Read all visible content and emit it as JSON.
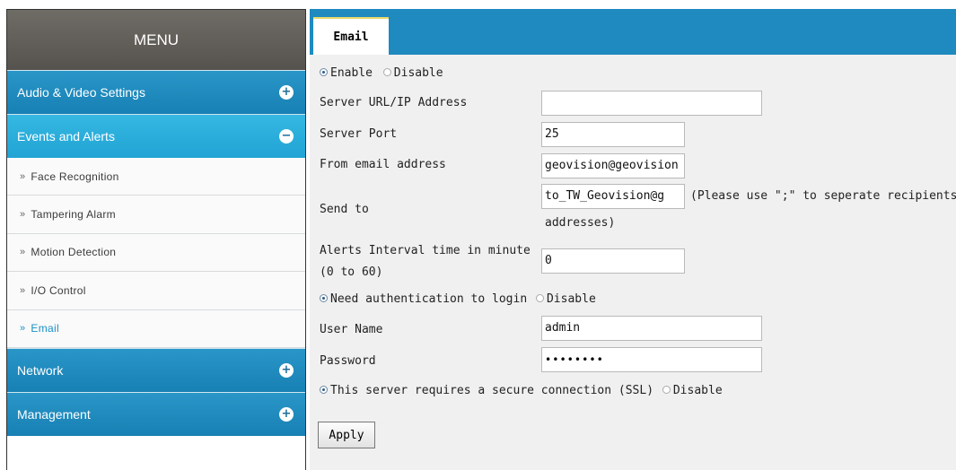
{
  "sidebar": {
    "title": "MENU",
    "categories": [
      {
        "label": "Audio & Video Settings",
        "toggle": "+"
      },
      {
        "label": "Events and Alerts",
        "toggle": "−"
      },
      {
        "label": "Network",
        "toggle": "+"
      },
      {
        "label": "Management",
        "toggle": "+"
      }
    ],
    "chevron": "»",
    "subitems": [
      {
        "label": "Face Recognition"
      },
      {
        "label": "Tampering Alarm"
      },
      {
        "label": "Motion Detection"
      },
      {
        "label": "I/O Control"
      },
      {
        "label": "Email",
        "selected": true
      }
    ]
  },
  "tab": {
    "label": "Email"
  },
  "form": {
    "enable_label": "Enable",
    "disable_label": "Disable",
    "server_url_label": "Server URL/IP Address",
    "server_url_value": "",
    "server_port_label": "Server Port",
    "server_port_value": "25",
    "from_label": "From email address",
    "from_value": "geovision@geovision",
    "send_to_label": "Send to",
    "send_to_value": "to_TW_Geovision@g",
    "send_to_hint_line1": "(Please use \";\" to seperate recipients'",
    "send_to_hint_line2": "addresses)",
    "interval_label_line1": "Alerts Interval time in minute",
    "interval_label_line2": "(0 to 60)",
    "interval_value": "0",
    "auth_label": "Need authentication to login",
    "auth_disable_label": "Disable",
    "username_label": "User Name",
    "username_value": "admin",
    "password_label": "Password",
    "password_value": "••••••••",
    "ssl_label": "This server requires a secure connection (SSL)",
    "ssl_disable_label": "Disable",
    "apply_label": "Apply"
  },
  "colors": {
    "menu_header": "#5f5c57",
    "category_blue": "#1a86bd",
    "category_active": "#2bafdf",
    "tab_bar": "#1f8ac0",
    "selected_sub": "#1a8fc6"
  }
}
